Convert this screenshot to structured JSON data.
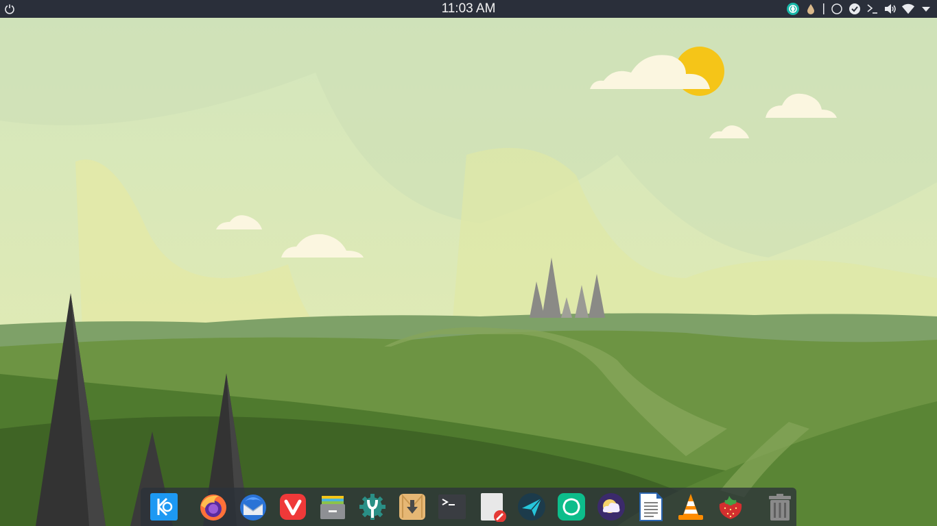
{
  "top_panel": {
    "clock": "11:03 AM",
    "tray_icons": [
      "vpn-icon",
      "droplet-icon",
      "separator",
      "circle-icon",
      "check-icon",
      "terminal-icon",
      "volume-icon",
      "wifi-icon",
      "dropdown-arrow-icon"
    ]
  },
  "dock": {
    "apps": [
      {
        "name": "kde-launcher",
        "icon": "kde-icon"
      },
      {
        "name": "firefox",
        "icon": "firefox-icon"
      },
      {
        "name": "thunderbird",
        "icon": "thunderbird-icon"
      },
      {
        "name": "vivaldi",
        "icon": "vivaldi-icon"
      },
      {
        "name": "file-manager",
        "icon": "file-cabinet-icon"
      },
      {
        "name": "system-settings",
        "icon": "settings-gear-icon"
      },
      {
        "name": "download-manager",
        "icon": "download-icon"
      },
      {
        "name": "terminal",
        "icon": "terminal-icon"
      },
      {
        "name": "text-editor",
        "icon": "text-editor-icon"
      },
      {
        "name": "telegram",
        "icon": "telegram-icon"
      },
      {
        "name": "element",
        "icon": "element-icon"
      },
      {
        "name": "weather",
        "icon": "weather-icon"
      },
      {
        "name": "libreoffice-writer",
        "icon": "writer-icon"
      },
      {
        "name": "vlc",
        "icon": "vlc-icon"
      },
      {
        "name": "strawberry",
        "icon": "strawberry-icon"
      },
      {
        "name": "trash",
        "icon": "trash-icon"
      }
    ]
  },
  "colors": {
    "panel": "#2a2f3a",
    "sky": "#d6e6b8",
    "sun": "#f5c518",
    "cloud": "#fbf6e0",
    "hill_dark": "#3f5f2a",
    "hill_mid": "#5f8a38",
    "tree": "#3a3a3a"
  }
}
